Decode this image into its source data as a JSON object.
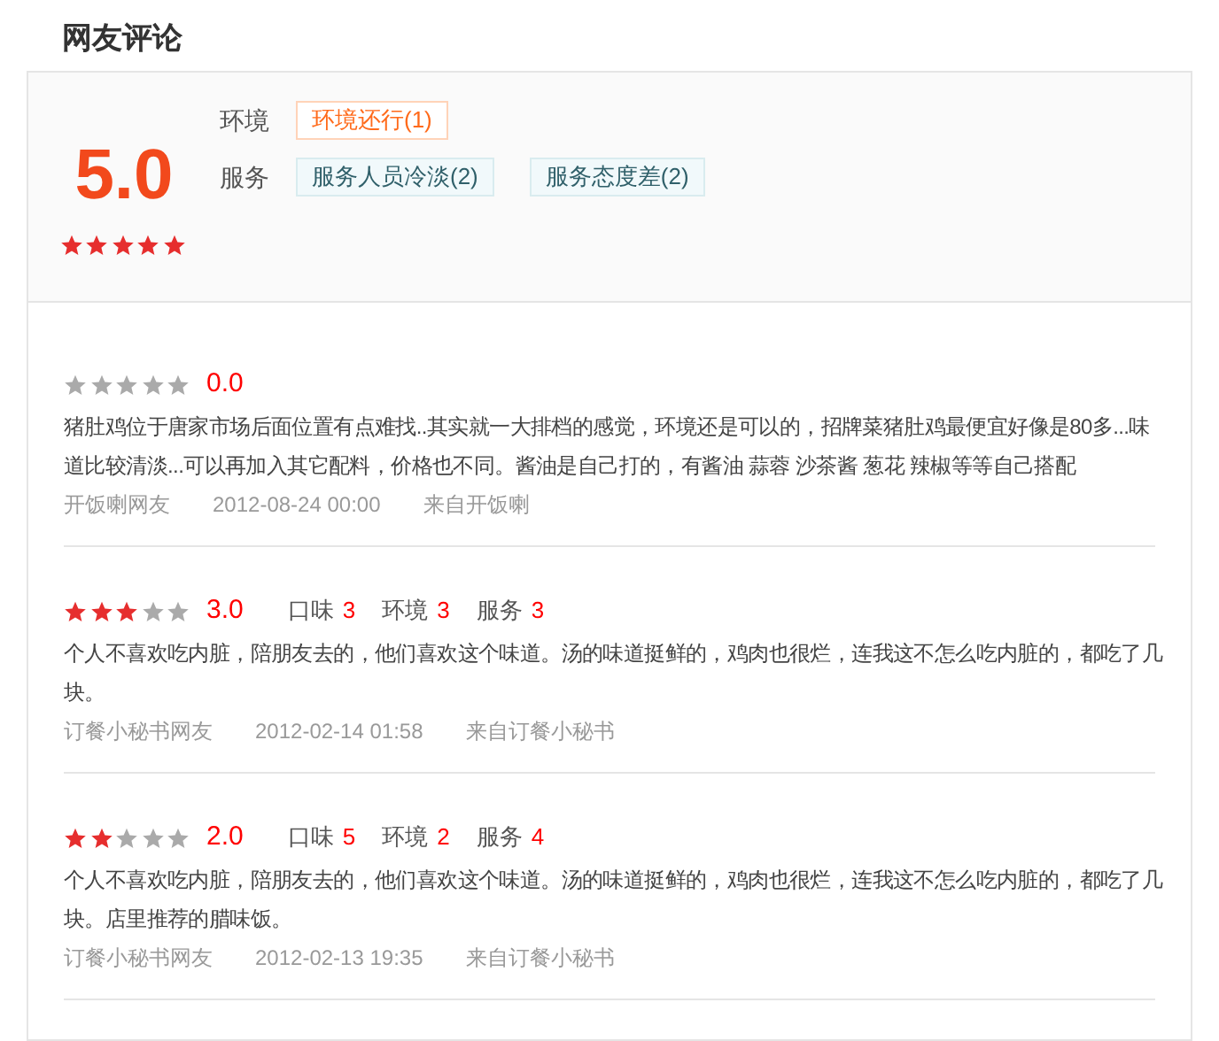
{
  "title": "网友评论",
  "summary": {
    "score": "5.0",
    "stars": 5,
    "groups": [
      {
        "label": "环境",
        "tags": [
          {
            "text": "环境还行(1)",
            "kind": "positive"
          }
        ]
      },
      {
        "label": "服务",
        "tags": [
          {
            "text": "服务人员冷淡(2)",
            "kind": "negative"
          },
          {
            "text": "服务态度差(2)",
            "kind": "negative"
          }
        ]
      }
    ]
  },
  "reviews": [
    {
      "stars": 0,
      "score": "0.0",
      "text": "猪肚鸡位于唐家市场后面位置有点难找..其实就一大排档的感觉，环境还是可以的，招牌菜猪肚鸡最便宜好像是80多...味道比较清淡...可以再加入其它配料，价格也不同。酱油是自己打的，有酱油 蒜蓉 沙茶酱 葱花 辣椒等等自己搭配",
      "user": "开饭喇网友",
      "time": "2012-08-24 00:00",
      "source": "来自开饭喇"
    },
    {
      "stars": 3,
      "score": "3.0",
      "sub_scores": [
        {
          "label": "口味",
          "value": "3"
        },
        {
          "label": "环境",
          "value": "3"
        },
        {
          "label": "服务",
          "value": "3"
        }
      ],
      "text": "个人不喜欢吃内脏，陪朋友去的，他们喜欢这个味道。汤的味道挺鲜的，鸡肉也很烂，连我这不怎么吃内脏的，都吃了几块。",
      "user": "订餐小秘书网友",
      "time": "2012-02-14 01:58",
      "source": "来自订餐小秘书"
    },
    {
      "stars": 2,
      "score": "2.0",
      "sub_scores": [
        {
          "label": "口味",
          "value": "5"
        },
        {
          "label": "环境",
          "value": "2"
        },
        {
          "label": "服务",
          "value": "4"
        }
      ],
      "text": "个人不喜欢吃内脏，陪朋友去的，他们喜欢这个味道。汤的味道挺鲜的，鸡肉也很烂，连我这不怎么吃内脏的，都吃了几块。店里推荐的腊味饭。",
      "user": "订餐小秘书网友",
      "time": "2012-02-13 19:35",
      "source": "来自订餐小秘书"
    }
  ]
}
